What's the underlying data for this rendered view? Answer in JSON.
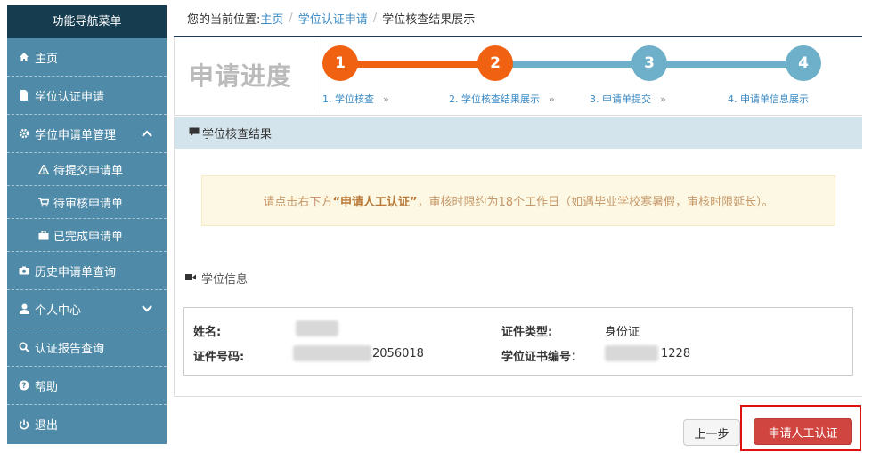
{
  "sidebar": {
    "title": "功能导航菜单",
    "items": [
      {
        "label": "主页",
        "icon": "home-icon"
      },
      {
        "label": "学位认证申请",
        "icon": "file-icon"
      },
      {
        "label": "学位申请单管理",
        "icon": "gear-icon",
        "chevron": "up"
      },
      {
        "label": "历史申请单查询",
        "icon": "camera-icon"
      },
      {
        "label": "个人中心",
        "icon": "user-icon",
        "chevron": "down"
      },
      {
        "label": "认证报告查询",
        "icon": "search-icon"
      },
      {
        "label": "帮助",
        "icon": "question-icon"
      },
      {
        "label": "退出",
        "icon": "power-icon"
      }
    ],
    "sub_items": [
      {
        "label": "待提交申请单",
        "icon": "warning-icon"
      },
      {
        "label": "待审核申请单",
        "icon": "cart-icon"
      },
      {
        "label": "已完成申请单",
        "icon": "briefcase-icon"
      }
    ]
  },
  "breadcrumb": {
    "prefix": "您的当前位置:",
    "home": "主页",
    "level1": "学位认证申请",
    "current": "学位核查结果展示"
  },
  "progress": {
    "title": "申请进度",
    "steps": [
      {
        "num": "1",
        "label": "1. 学位核查",
        "status": "done"
      },
      {
        "num": "2",
        "label": "2. 学位核查结果展示",
        "status": "done"
      },
      {
        "num": "3",
        "label": "3. 申请单提交",
        "status": "todo"
      },
      {
        "num": "4",
        "label": "4. 申请单信息展示",
        "status": "todo"
      }
    ],
    "arrow": "»"
  },
  "section": {
    "title": "学位核查结果"
  },
  "notice": {
    "pre": "请点击右下方",
    "highlight": "“申请人工认证”",
    "post": "，审核时限约为18个工作日（如遇毕业学校寒暑假，审核时限延长）。"
  },
  "info": {
    "title": "学位信息",
    "name_label": "姓名:",
    "id_type_label": "证件类型:",
    "id_type_value": "身份证",
    "id_number_label": "证件号码:",
    "id_number_visible": "2056018",
    "cert_no_label": "学位证书编号：",
    "cert_no_visible": "1228"
  },
  "buttons": {
    "prev": "上一步",
    "apply": "申请人工认证"
  },
  "colors": {
    "sidebar_bg": "#4f8ba8",
    "sidebar_head": "#163c50",
    "step_done": "#f06212",
    "step_todo": "#6eafc9",
    "apply_btn": "#d0453f",
    "highlight_box": "#e01010"
  }
}
